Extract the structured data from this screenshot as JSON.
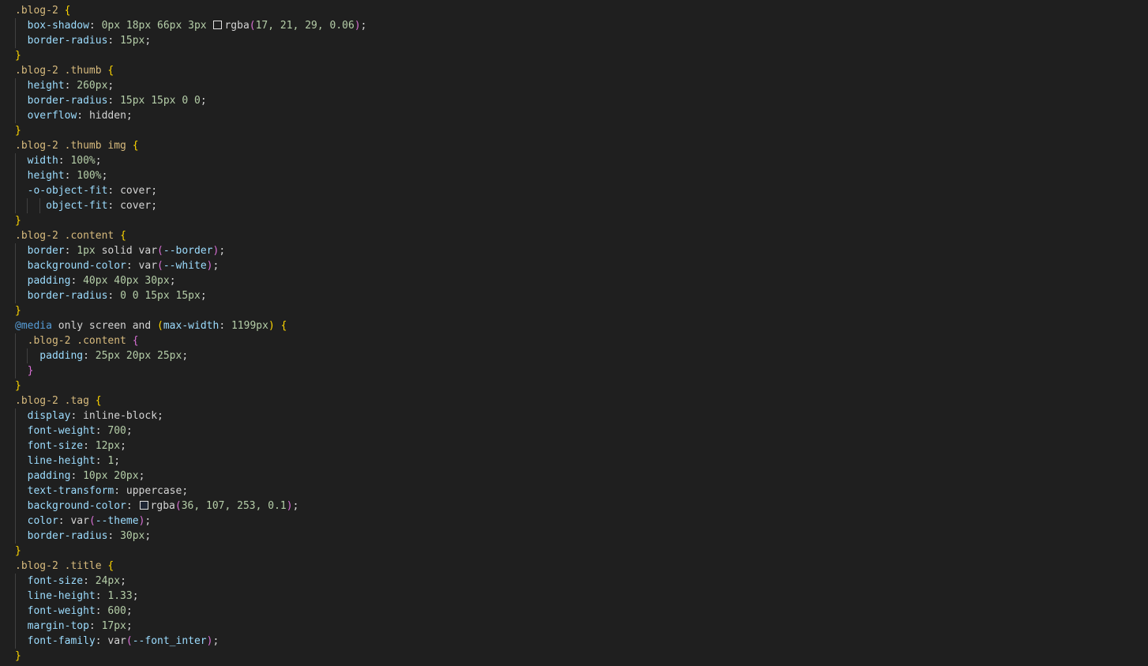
{
  "editor": {
    "language": "css",
    "lines": [
      [
        {
          "t": ".blog-2 ",
          "c": "sel"
        },
        {
          "t": "{",
          "c": "brace"
        }
      ],
      [
        {
          "t": "  box-shadow",
          "c": "prop"
        },
        {
          "t": ": ",
          "c": "punct"
        },
        {
          "t": "0px 18px 66px 3px ",
          "c": "num"
        },
        {
          "sw": "rgba(17,21,29,0.06)"
        },
        {
          "t": "rgba",
          "c": "val"
        },
        {
          "t": "(",
          "c": "paren"
        },
        {
          "t": "17, 21, 29, 0.06",
          "c": "num"
        },
        {
          "t": ")",
          "c": "paren"
        },
        {
          "t": ";",
          "c": "punct"
        }
      ],
      [
        {
          "t": "  border-radius",
          "c": "prop"
        },
        {
          "t": ": ",
          "c": "punct"
        },
        {
          "t": "15px",
          "c": "num"
        },
        {
          "t": ";",
          "c": "punct"
        }
      ],
      [
        {
          "t": "}",
          "c": "brace"
        }
      ],
      [
        {
          "t": ".blog-2 .thumb ",
          "c": "sel"
        },
        {
          "t": "{",
          "c": "brace"
        }
      ],
      [
        {
          "t": "  height",
          "c": "prop"
        },
        {
          "t": ": ",
          "c": "punct"
        },
        {
          "t": "260px",
          "c": "num"
        },
        {
          "t": ";",
          "c": "punct"
        }
      ],
      [
        {
          "t": "  border-radius",
          "c": "prop"
        },
        {
          "t": ": ",
          "c": "punct"
        },
        {
          "t": "15px 15px 0 0",
          "c": "num"
        },
        {
          "t": ";",
          "c": "punct"
        }
      ],
      [
        {
          "t": "  overflow",
          "c": "prop"
        },
        {
          "t": ": ",
          "c": "punct"
        },
        {
          "t": "hidden",
          "c": "val"
        },
        {
          "t": ";",
          "c": "punct"
        }
      ],
      [
        {
          "t": "}",
          "c": "brace"
        }
      ],
      [
        {
          "t": ".blog-2 .thumb img ",
          "c": "sel"
        },
        {
          "t": "{",
          "c": "brace"
        }
      ],
      [
        {
          "t": "  width",
          "c": "prop"
        },
        {
          "t": ": ",
          "c": "punct"
        },
        {
          "t": "100%",
          "c": "num"
        },
        {
          "t": ";",
          "c": "punct"
        }
      ],
      [
        {
          "t": "  height",
          "c": "prop"
        },
        {
          "t": ": ",
          "c": "punct"
        },
        {
          "t": "100%",
          "c": "num"
        },
        {
          "t": ";",
          "c": "punct"
        }
      ],
      [
        {
          "t": "  -o-object-fit",
          "c": "prop"
        },
        {
          "t": ": ",
          "c": "punct"
        },
        {
          "t": "cover",
          "c": "val"
        },
        {
          "t": ";",
          "c": "punct"
        }
      ],
      [
        {
          "t": "     object-fit",
          "c": "prop"
        },
        {
          "t": ": ",
          "c": "punct"
        },
        {
          "t": "cover",
          "c": "val"
        },
        {
          "t": ";",
          "c": "punct"
        }
      ],
      [
        {
          "t": "}",
          "c": "brace"
        }
      ],
      [
        {
          "t": ".blog-2 .content ",
          "c": "sel"
        },
        {
          "t": "{",
          "c": "brace"
        }
      ],
      [
        {
          "t": "  border",
          "c": "prop"
        },
        {
          "t": ": ",
          "c": "punct"
        },
        {
          "t": "1px ",
          "c": "num"
        },
        {
          "t": "solid var",
          "c": "val"
        },
        {
          "t": "(",
          "c": "paren"
        },
        {
          "t": "--border",
          "c": "var"
        },
        {
          "t": ")",
          "c": "paren"
        },
        {
          "t": ";",
          "c": "punct"
        }
      ],
      [
        {
          "t": "  background-color",
          "c": "prop"
        },
        {
          "t": ": ",
          "c": "punct"
        },
        {
          "t": "var",
          "c": "val"
        },
        {
          "t": "(",
          "c": "paren"
        },
        {
          "t": "--white",
          "c": "var"
        },
        {
          "t": ")",
          "c": "paren"
        },
        {
          "t": ";",
          "c": "punct"
        }
      ],
      [
        {
          "t": "  padding",
          "c": "prop"
        },
        {
          "t": ": ",
          "c": "punct"
        },
        {
          "t": "40px 40px 30px",
          "c": "num"
        },
        {
          "t": ";",
          "c": "punct"
        }
      ],
      [
        {
          "t": "  border-radius",
          "c": "prop"
        },
        {
          "t": ": ",
          "c": "punct"
        },
        {
          "t": "0 0 15px 15px",
          "c": "num"
        },
        {
          "t": ";",
          "c": "punct"
        }
      ],
      [
        {
          "t": "}",
          "c": "brace"
        }
      ],
      [
        {
          "t": "@media",
          "c": "at"
        },
        {
          "t": " only screen and ",
          "c": "val"
        },
        {
          "t": "(",
          "c": "brace"
        },
        {
          "t": "max-width",
          "c": "prop"
        },
        {
          "t": ": ",
          "c": "punct"
        },
        {
          "t": "1199px",
          "c": "num"
        },
        {
          "t": ")",
          "c": "brace"
        },
        {
          "t": " ",
          "c": "val"
        },
        {
          "t": "{",
          "c": "brace"
        }
      ],
      [
        {
          "t": "  .blog-2 .content ",
          "c": "sel"
        },
        {
          "t": "{",
          "c": "brace2"
        }
      ],
      [
        {
          "t": "    padding",
          "c": "prop"
        },
        {
          "t": ": ",
          "c": "punct"
        },
        {
          "t": "25px 20px 25px",
          "c": "num"
        },
        {
          "t": ";",
          "c": "punct"
        }
      ],
      [
        {
          "t": "  }",
          "c": "brace2"
        }
      ],
      [
        {
          "t": "}",
          "c": "brace"
        }
      ],
      [
        {
          "t": ".blog-2 .tag ",
          "c": "sel"
        },
        {
          "t": "{",
          "c": "brace"
        }
      ],
      [
        {
          "t": "  display",
          "c": "prop"
        },
        {
          "t": ": ",
          "c": "punct"
        },
        {
          "t": "inline-block",
          "c": "val"
        },
        {
          "t": ";",
          "c": "punct"
        }
      ],
      [
        {
          "t": "  font-weight",
          "c": "prop"
        },
        {
          "t": ": ",
          "c": "punct"
        },
        {
          "t": "700",
          "c": "num"
        },
        {
          "t": ";",
          "c": "punct"
        }
      ],
      [
        {
          "t": "  font-size",
          "c": "prop"
        },
        {
          "t": ": ",
          "c": "punct"
        },
        {
          "t": "12px",
          "c": "num"
        },
        {
          "t": ";",
          "c": "punct"
        }
      ],
      [
        {
          "t": "  line-height",
          "c": "prop"
        },
        {
          "t": ": ",
          "c": "punct"
        },
        {
          "t": "1",
          "c": "num"
        },
        {
          "t": ";",
          "c": "punct"
        }
      ],
      [
        {
          "t": "  padding",
          "c": "prop"
        },
        {
          "t": ": ",
          "c": "punct"
        },
        {
          "t": "10px 20px",
          "c": "num"
        },
        {
          "t": ";",
          "c": "punct"
        }
      ],
      [
        {
          "t": "  text-transform",
          "c": "prop"
        },
        {
          "t": ": ",
          "c": "punct"
        },
        {
          "t": "uppercase",
          "c": "val"
        },
        {
          "t": ";",
          "c": "punct"
        }
      ],
      [
        {
          "t": "  background-color",
          "c": "prop"
        },
        {
          "t": ": ",
          "c": "punct"
        },
        {
          "sw": "rgba(36,107,253,0.1)"
        },
        {
          "t": "rgba",
          "c": "val"
        },
        {
          "t": "(",
          "c": "paren"
        },
        {
          "t": "36, 107, 253, 0.1",
          "c": "num"
        },
        {
          "t": ")",
          "c": "paren"
        },
        {
          "t": ";",
          "c": "punct"
        }
      ],
      [
        {
          "t": "  color",
          "c": "prop"
        },
        {
          "t": ": ",
          "c": "punct"
        },
        {
          "t": "var",
          "c": "val"
        },
        {
          "t": "(",
          "c": "paren"
        },
        {
          "t": "--theme",
          "c": "var"
        },
        {
          "t": ")",
          "c": "paren"
        },
        {
          "t": ";",
          "c": "punct"
        }
      ],
      [
        {
          "t": "  border-radius",
          "c": "prop"
        },
        {
          "t": ": ",
          "c": "punct"
        },
        {
          "t": "30px",
          "c": "num"
        },
        {
          "t": ";",
          "c": "punct"
        }
      ],
      [
        {
          "t": "}",
          "c": "brace"
        }
      ],
      [
        {
          "t": ".blog-2 .title ",
          "c": "sel"
        },
        {
          "t": "{",
          "c": "brace"
        }
      ],
      [
        {
          "t": "  font-size",
          "c": "prop"
        },
        {
          "t": ": ",
          "c": "punct"
        },
        {
          "t": "24px",
          "c": "num"
        },
        {
          "t": ";",
          "c": "punct"
        }
      ],
      [
        {
          "t": "  line-height",
          "c": "prop"
        },
        {
          "t": ": ",
          "c": "punct"
        },
        {
          "t": "1.33",
          "c": "num"
        },
        {
          "t": ";",
          "c": "punct"
        }
      ],
      [
        {
          "t": "  font-weight",
          "c": "prop"
        },
        {
          "t": ": ",
          "c": "punct"
        },
        {
          "t": "600",
          "c": "num"
        },
        {
          "t": ";",
          "c": "punct"
        }
      ],
      [
        {
          "t": "  margin-top",
          "c": "prop"
        },
        {
          "t": ": ",
          "c": "punct"
        },
        {
          "t": "17px",
          "c": "num"
        },
        {
          "t": ";",
          "c": "punct"
        }
      ],
      [
        {
          "t": "  font-family",
          "c": "prop"
        },
        {
          "t": ": ",
          "c": "punct"
        },
        {
          "t": "var",
          "c": "val"
        },
        {
          "t": "(",
          "c": "paren"
        },
        {
          "t": "--font_inter",
          "c": "var"
        },
        {
          "t": ")",
          "c": "paren"
        },
        {
          "t": ";",
          "c": "punct"
        }
      ],
      [
        {
          "t": "}",
          "c": "brace"
        }
      ]
    ]
  }
}
